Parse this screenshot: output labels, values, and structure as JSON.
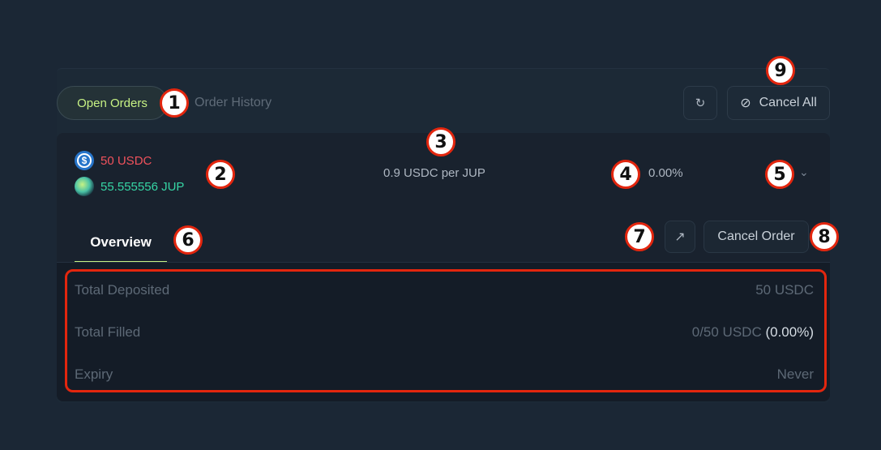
{
  "tabs": {
    "open_orders": "Open Orders",
    "order_history": "Order History"
  },
  "toolbar": {
    "refresh_icon": "↻",
    "cancel_all_icon": "⊘",
    "cancel_all_label": "Cancel All"
  },
  "order": {
    "sell_amount": "50 USDC",
    "buy_amount": "55.555556 JUP",
    "price": "0.9 USDC per JUP",
    "filled_percent": "0.00%",
    "chevron_icon": "⌄"
  },
  "details_header": {
    "overview_tab": "Overview",
    "external_icon": "↗",
    "cancel_order_label": "Cancel Order"
  },
  "details": {
    "total_deposited_label": "Total Deposited",
    "total_deposited_value": "50 USDC",
    "total_filled_label": "Total Filled",
    "total_filled_value": "0/50 USDC",
    "total_filled_percent": "(0.00%)",
    "expiry_label": "Expiry",
    "expiry_value": "Never"
  },
  "annotations": [
    "1",
    "2",
    "3",
    "4",
    "5",
    "6",
    "7",
    "8",
    "9"
  ],
  "colors": {
    "accent": "#c7f284",
    "sell": "#f0525c",
    "buy": "#36d6a5",
    "annotation": "#e3260e"
  }
}
